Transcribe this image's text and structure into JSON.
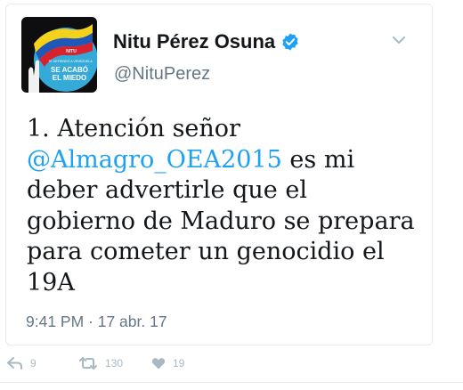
{
  "tweet": {
    "author_name": "Nitu Pérez Osuna",
    "handle": "@NituPerez",
    "text_prefix": "1. Atención señor ",
    "mention": "@Almagro_OEA2015",
    "text_suffix": " es mi deber advertirle que el gobierno de Maduro se prepara para cometer un genocidio el 19A",
    "timestamp": "9:41 PM · 17 abr. 17",
    "avatar": {
      "small_label": "NITU",
      "tagline": "TE DEFIENDO A VENEZUELA",
      "slogan_line1": "SE ACABÓ",
      "slogan_line2": "EL MIEDO"
    }
  },
  "actions": {
    "reply_count": "9",
    "retweet_count": "130",
    "like_count": "19"
  },
  "colors": {
    "accent": "#1da1f2",
    "text": "#14171a",
    "muted": "#657786",
    "action_icon": "#aab8c2"
  },
  "icons": [
    "verified-badge-icon",
    "chevron-down-icon",
    "reply-icon",
    "retweet-icon",
    "like-icon"
  ]
}
